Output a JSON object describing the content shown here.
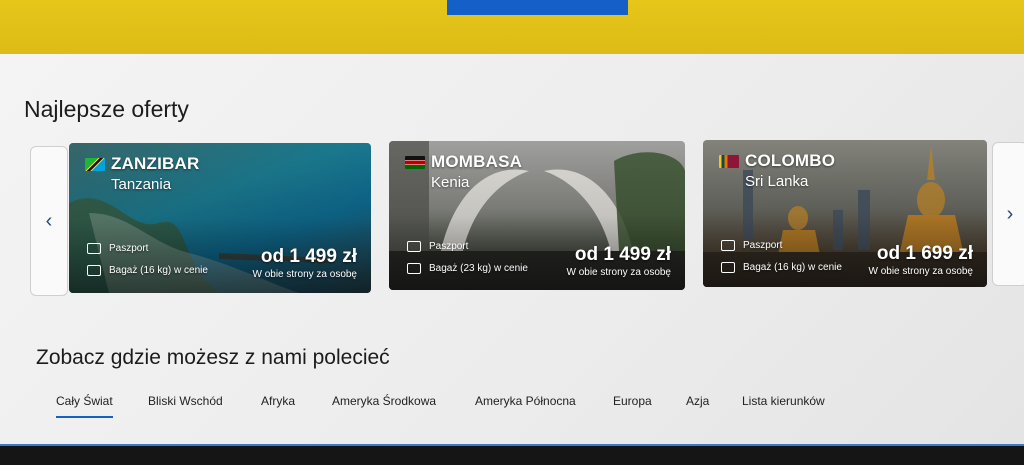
{
  "section_title": "Najlepsze oferty",
  "section2_title": "Zobacz gdzie możesz z nami polecieć",
  "nav": {
    "prev": "‹",
    "next": "›"
  },
  "offers": [
    {
      "city": "ZANZIBAR",
      "country": "Tanzania",
      "feature1": "Paszport",
      "feature2": "Bagaż (16 kg) w cenie",
      "price": "od 1 499 zł",
      "price_note": "W obie strony za osobę",
      "flag": "tanzania-flag-icon"
    },
    {
      "city": "MOMBASA",
      "country": "Kenia",
      "feature1": "Paszport",
      "feature2": "Bagaż (23 kg) w cenie",
      "price": "od 1 499 zł",
      "price_note": "W obie strony za osobę",
      "flag": "kenya-flag-icon"
    },
    {
      "city": "COLOMBO",
      "country": "Sri Lanka",
      "feature1": "Paszport",
      "feature2": "Bagaż (16 kg) w cenie",
      "price": "od 1 699 zł",
      "price_note": "W obie strony za osobę",
      "flag": "sri-lanka-flag-icon"
    }
  ],
  "tabs": [
    "Cały Świat",
    "Bliski Wschód",
    "Afryka",
    "Ameryka Środkowa",
    "Ameryka Północna",
    "Europa",
    "Azja",
    "Lista kierunków"
  ],
  "active_tab": "Cały Świat",
  "colors": {
    "accent": "#1460c8",
    "header": "#e6c619"
  }
}
